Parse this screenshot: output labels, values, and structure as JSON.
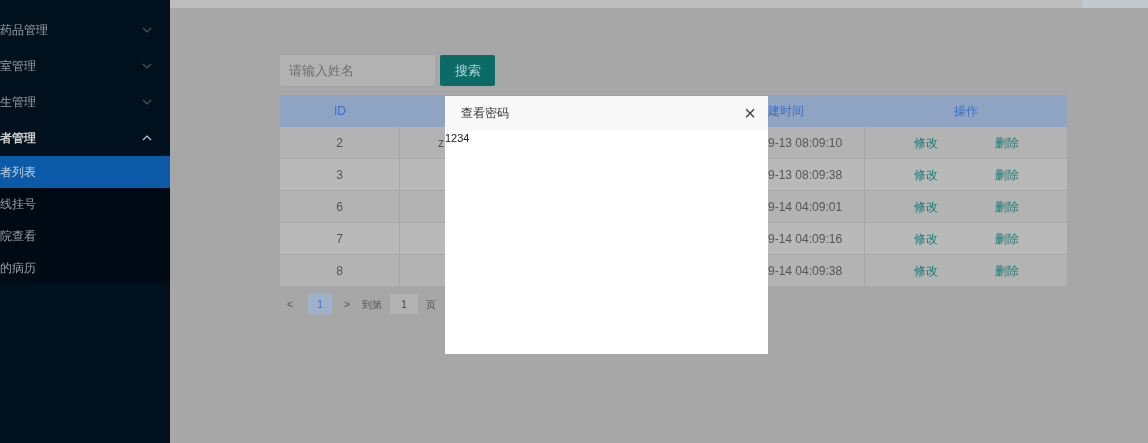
{
  "sidebar": {
    "items": [
      {
        "label": "药品管理",
        "expanded": false
      },
      {
        "label": "室管理",
        "expanded": false
      },
      {
        "label": "生管理",
        "expanded": false
      },
      {
        "label": "者管理",
        "expanded": true,
        "children": [
          {
            "label": "者列表",
            "selected": true
          },
          {
            "label": "线挂号",
            "selected": false
          },
          {
            "label": "院查看",
            "selected": false
          },
          {
            "label": "的病历",
            "selected": false
          }
        ]
      }
    ]
  },
  "search": {
    "placeholder": "请输入姓名",
    "button": "搜索"
  },
  "table": {
    "column_1": "ID",
    "column_4": "建时间",
    "column_5": "操作",
    "rows": [
      {
        "id": "2",
        "column_2": "z",
        "created": "9-13 08:09:10",
        "actions": [
          "修改",
          "删除"
        ]
      },
      {
        "id": "3",
        "created": "9-13 08:09:38",
        "actions": [
          "修改",
          "删除"
        ]
      },
      {
        "id": "6",
        "created": "9-14 04:09:01",
        "actions": [
          "修改",
          "删除"
        ]
      },
      {
        "id": "7",
        "created": "9-14 04:09:16",
        "actions": [
          "修改",
          "删除"
        ]
      },
      {
        "id": "8",
        "created": "9-14 04:09:38",
        "actions": [
          "修改",
          "删除"
        ]
      }
    ]
  },
  "pagination": {
    "prev": "<",
    "pages": [
      {
        "label": "1",
        "selected": true
      }
    ],
    "next": ">",
    "goto_label": "到第",
    "goto_value": "1",
    "page_unit": "页"
  },
  "dialog": {
    "title": "查看密码",
    "close": "×",
    "content": "1234"
  }
}
